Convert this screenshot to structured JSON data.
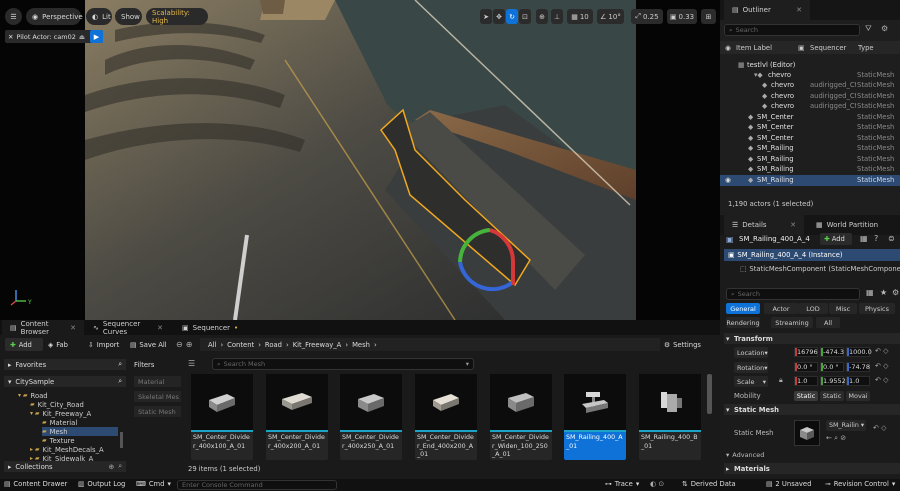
{
  "viewport": {
    "toolbar": {
      "perspective": "Perspective",
      "lit": "Lit",
      "show": "Show",
      "scalability": "Scalability: High",
      "grid_value": "10",
      "angle_value": "10°",
      "scale_value": "0.25",
      "speed_value": "0.33"
    },
    "pilot": "Pilot Actor: cam02"
  },
  "outliner": {
    "tab": "Outliner",
    "search_placeholder": "Search",
    "columns": [
      "Item Label",
      "Sequencer",
      "Type"
    ],
    "rows": [
      {
        "label": "testlvl (Editor)",
        "seq": "",
        "type": ""
      },
      {
        "label": "chevro",
        "seq": "",
        "type": "StaticMesh"
      },
      {
        "label": "chevro",
        "seq": "audirigged_Ctrl",
        "type": "StaticMesh"
      },
      {
        "label": "chevro",
        "seq": "audirigged_Ctrl",
        "type": "StaticMesh"
      },
      {
        "label": "chevro",
        "seq": "audirigged_Ctrl",
        "type": "StaticMesh"
      },
      {
        "label": "SM_Center",
        "seq": "",
        "type": "StaticMesh"
      },
      {
        "label": "SM_Center",
        "seq": "",
        "type": "StaticMesh"
      },
      {
        "label": "SM_Center",
        "seq": "",
        "type": "StaticMesh"
      },
      {
        "label": "SM_Railing",
        "seq": "",
        "type": "StaticMesh"
      },
      {
        "label": "SM_Railing",
        "seq": "",
        "type": "StaticMesh"
      },
      {
        "label": "SM_Railing",
        "seq": "",
        "type": "StaticMesh"
      },
      {
        "label": "SM_Railing",
        "seq": "",
        "type": "StaticMesh"
      }
    ],
    "status": "1,190 actors (1 selected)"
  },
  "details": {
    "tabs": [
      "Details",
      "World Partition"
    ],
    "actor_name": "SM_Railing_400_A_4",
    "add_label": "Add",
    "instance": "SM_Railing_400_A_4 (Instance)",
    "component": "StaticMeshComponent (StaticMeshComponent)",
    "search_placeholder": "Search",
    "filter_tabs": [
      "General",
      "Actor",
      "LOD",
      "Misc",
      "Physics",
      "Rendering",
      "Streaming",
      "All"
    ],
    "transform_header": "Transform",
    "location_label": "Location",
    "location": [
      "16796",
      "-474.3",
      "1000.0"
    ],
    "rotation_label": "Rotation",
    "rotation": [
      "0.0 °",
      "0.0 °",
      "-74.78"
    ],
    "scale_label": "Scale",
    "scale": [
      "1.0",
      "1.9552",
      "1.0"
    ],
    "mobility_label": "Mobility",
    "mobility": [
      "Static",
      "Static",
      "Movai"
    ],
    "static_mesh_header": "Static Mesh",
    "static_mesh_label": "Static Mesh",
    "static_mesh_value": "SM_Railin",
    "advanced": "Advanced",
    "materials": "Materials"
  },
  "content_browser": {
    "tabs": [
      "Content Browser",
      "Sequencer Curves",
      "Sequencer"
    ],
    "add": "Add",
    "fab": "Fab",
    "import": "Import",
    "save_all": "Save All",
    "breadcrumb": [
      "All",
      "Content",
      "Road",
      "Kit_Freeway_A",
      "Mesh"
    ],
    "settings": "Settings",
    "favorites": "Favorites",
    "root": "CitySample",
    "tree": [
      {
        "label": "Road"
      },
      {
        "label": "Kit_City_Road"
      },
      {
        "label": "Kit_Freeway_A"
      },
      {
        "label": "Material"
      },
      {
        "label": "Mesh"
      },
      {
        "label": "Texture"
      },
      {
        "label": "Kit_MeshDecals_A"
      },
      {
        "label": "Kit_Sidewalk_A"
      }
    ],
    "collections": "Collections",
    "filters_title": "Filters",
    "filters": [
      "Material",
      "Skeletal Mes",
      "Static Mesh"
    ],
    "search_placeholder": "Search Mesh",
    "assets": [
      "SM_Center_Divider_400x100_A_01",
      "SM_Center_Divider_400x200_A_01",
      "SM_Center_Divider_400x250_A_01",
      "SM_Center_Divider_End_400x200_A_01",
      "SM_Center_Divider_Widen_100_250_A_01",
      "SM_Railing_400_A_01",
      "SM_Railing_400_B_01"
    ],
    "count": "29 items (1 selected)"
  },
  "statusbar": {
    "content_drawer": "Content Drawer",
    "output_log": "Output Log",
    "cmd": "Cmd",
    "console_placeholder": "Enter Console Command",
    "trace": "Trace",
    "derived": "Derived Data",
    "unsaved": "2 Unsaved",
    "revision": "Revision Control"
  },
  "colors": {
    "accent": "#0e72d8",
    "select_row": "#2c4a72",
    "scalability": "#e8b84a",
    "selection_outline": "#f0a820"
  }
}
